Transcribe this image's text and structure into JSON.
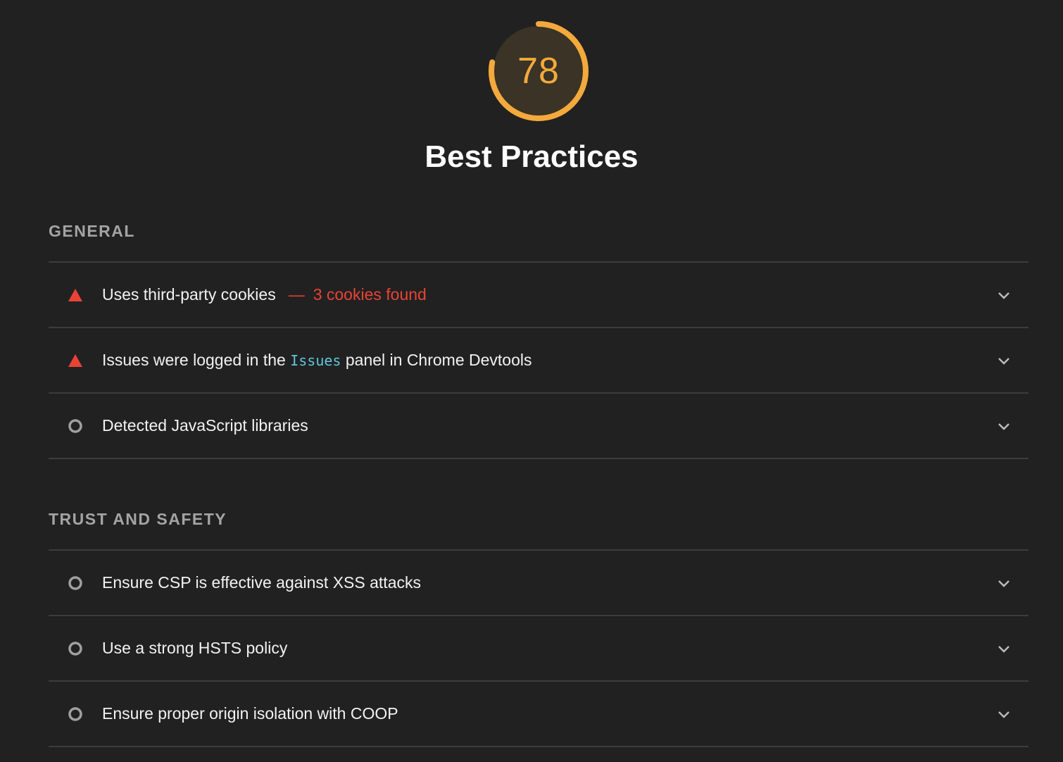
{
  "gauge": {
    "score": "78",
    "fraction": 0.78,
    "color": "#f4a93d",
    "track_color": "#3a3326"
  },
  "category": {
    "title": "Best Practices"
  },
  "groups": [
    {
      "header": "GENERAL",
      "audits": [
        {
          "status": "fail",
          "status_icon": "red-triangle-icon",
          "title_before": "Uses third-party cookies",
          "separator": "—",
          "display_value": "3 cookies found"
        },
        {
          "status": "fail",
          "status_icon": "red-triangle-icon",
          "title_before": "Issues were logged in the",
          "code": "Issues",
          "title_after": "panel in Chrome Devtools"
        },
        {
          "status": "informative",
          "status_icon": "grey-circle-icon",
          "title_before": "Detected JavaScript libraries"
        }
      ]
    },
    {
      "header": "TRUST AND SAFETY",
      "audits": [
        {
          "status": "informative",
          "status_icon": "grey-circle-icon",
          "title_before": "Ensure CSP is effective against XSS attacks"
        },
        {
          "status": "informative",
          "status_icon": "grey-circle-icon",
          "title_before": "Use a strong HSTS policy"
        },
        {
          "status": "informative",
          "status_icon": "grey-circle-icon",
          "title_before": "Ensure proper origin isolation with COOP"
        }
      ]
    }
  ],
  "colors": {
    "fail": "#ea4335",
    "informative": "#a0a0a0",
    "background": "#212121",
    "code": "#5ec7db"
  }
}
